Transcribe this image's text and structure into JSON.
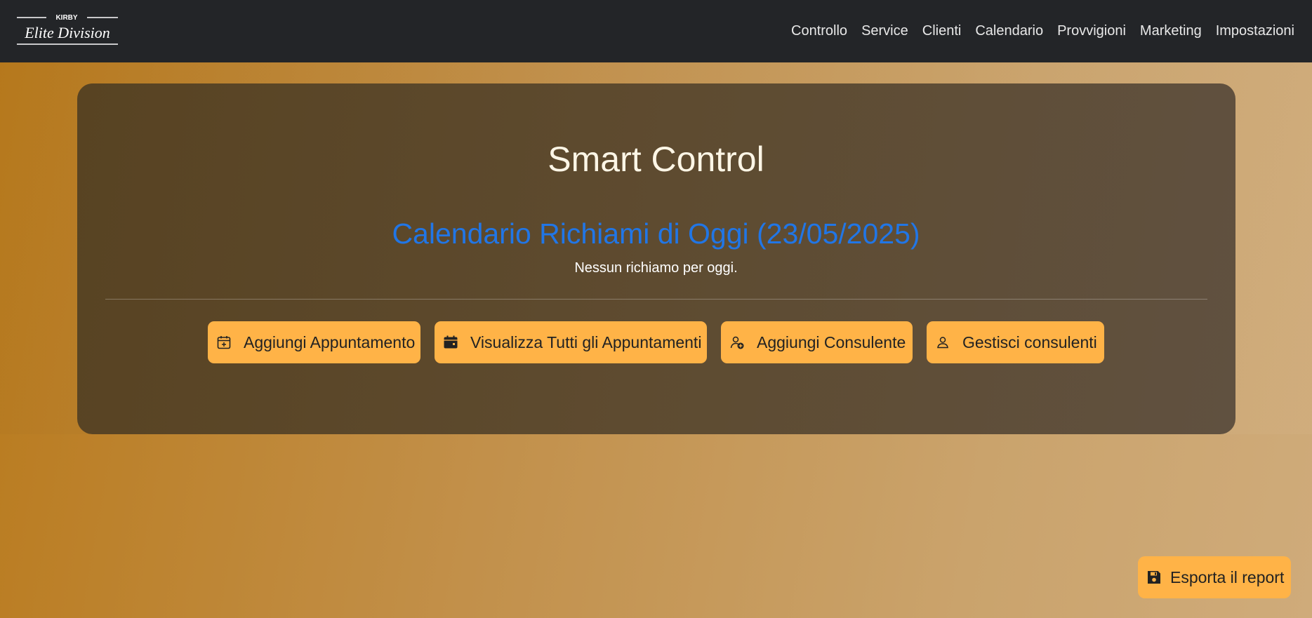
{
  "brand": {
    "logo_top": "KIRBY",
    "logo_main": "Elite Division"
  },
  "nav": {
    "items": [
      "Controllo",
      "Service",
      "Clienti",
      "Calendario",
      "Provvigioni",
      "Marketing",
      "Impostazioni"
    ]
  },
  "main": {
    "title": "Smart Control",
    "calendar_heading": "Calendario Richiami di Oggi (23/05/2025)",
    "empty_message": "Nessun richiamo per oggi.",
    "actions": [
      {
        "label": "Aggiungi Appuntamento",
        "icon": "calendar-plus-icon"
      },
      {
        "label": "Visualizza Tutti gli Appuntamenti",
        "icon": "calendar-filled-icon"
      },
      {
        "label": "Aggiungi Consulente",
        "icon": "person-add-icon"
      },
      {
        "label": "Gestisci consulenti",
        "icon": "person-icon"
      }
    ]
  },
  "export": {
    "label": "Esporta il report",
    "icon": "floppy-disk-icon"
  },
  "colors": {
    "navbar": "#232528",
    "accent_button": "#ffb347",
    "heading_blue": "#2176e6",
    "title_cream": "#fdf6e6"
  }
}
